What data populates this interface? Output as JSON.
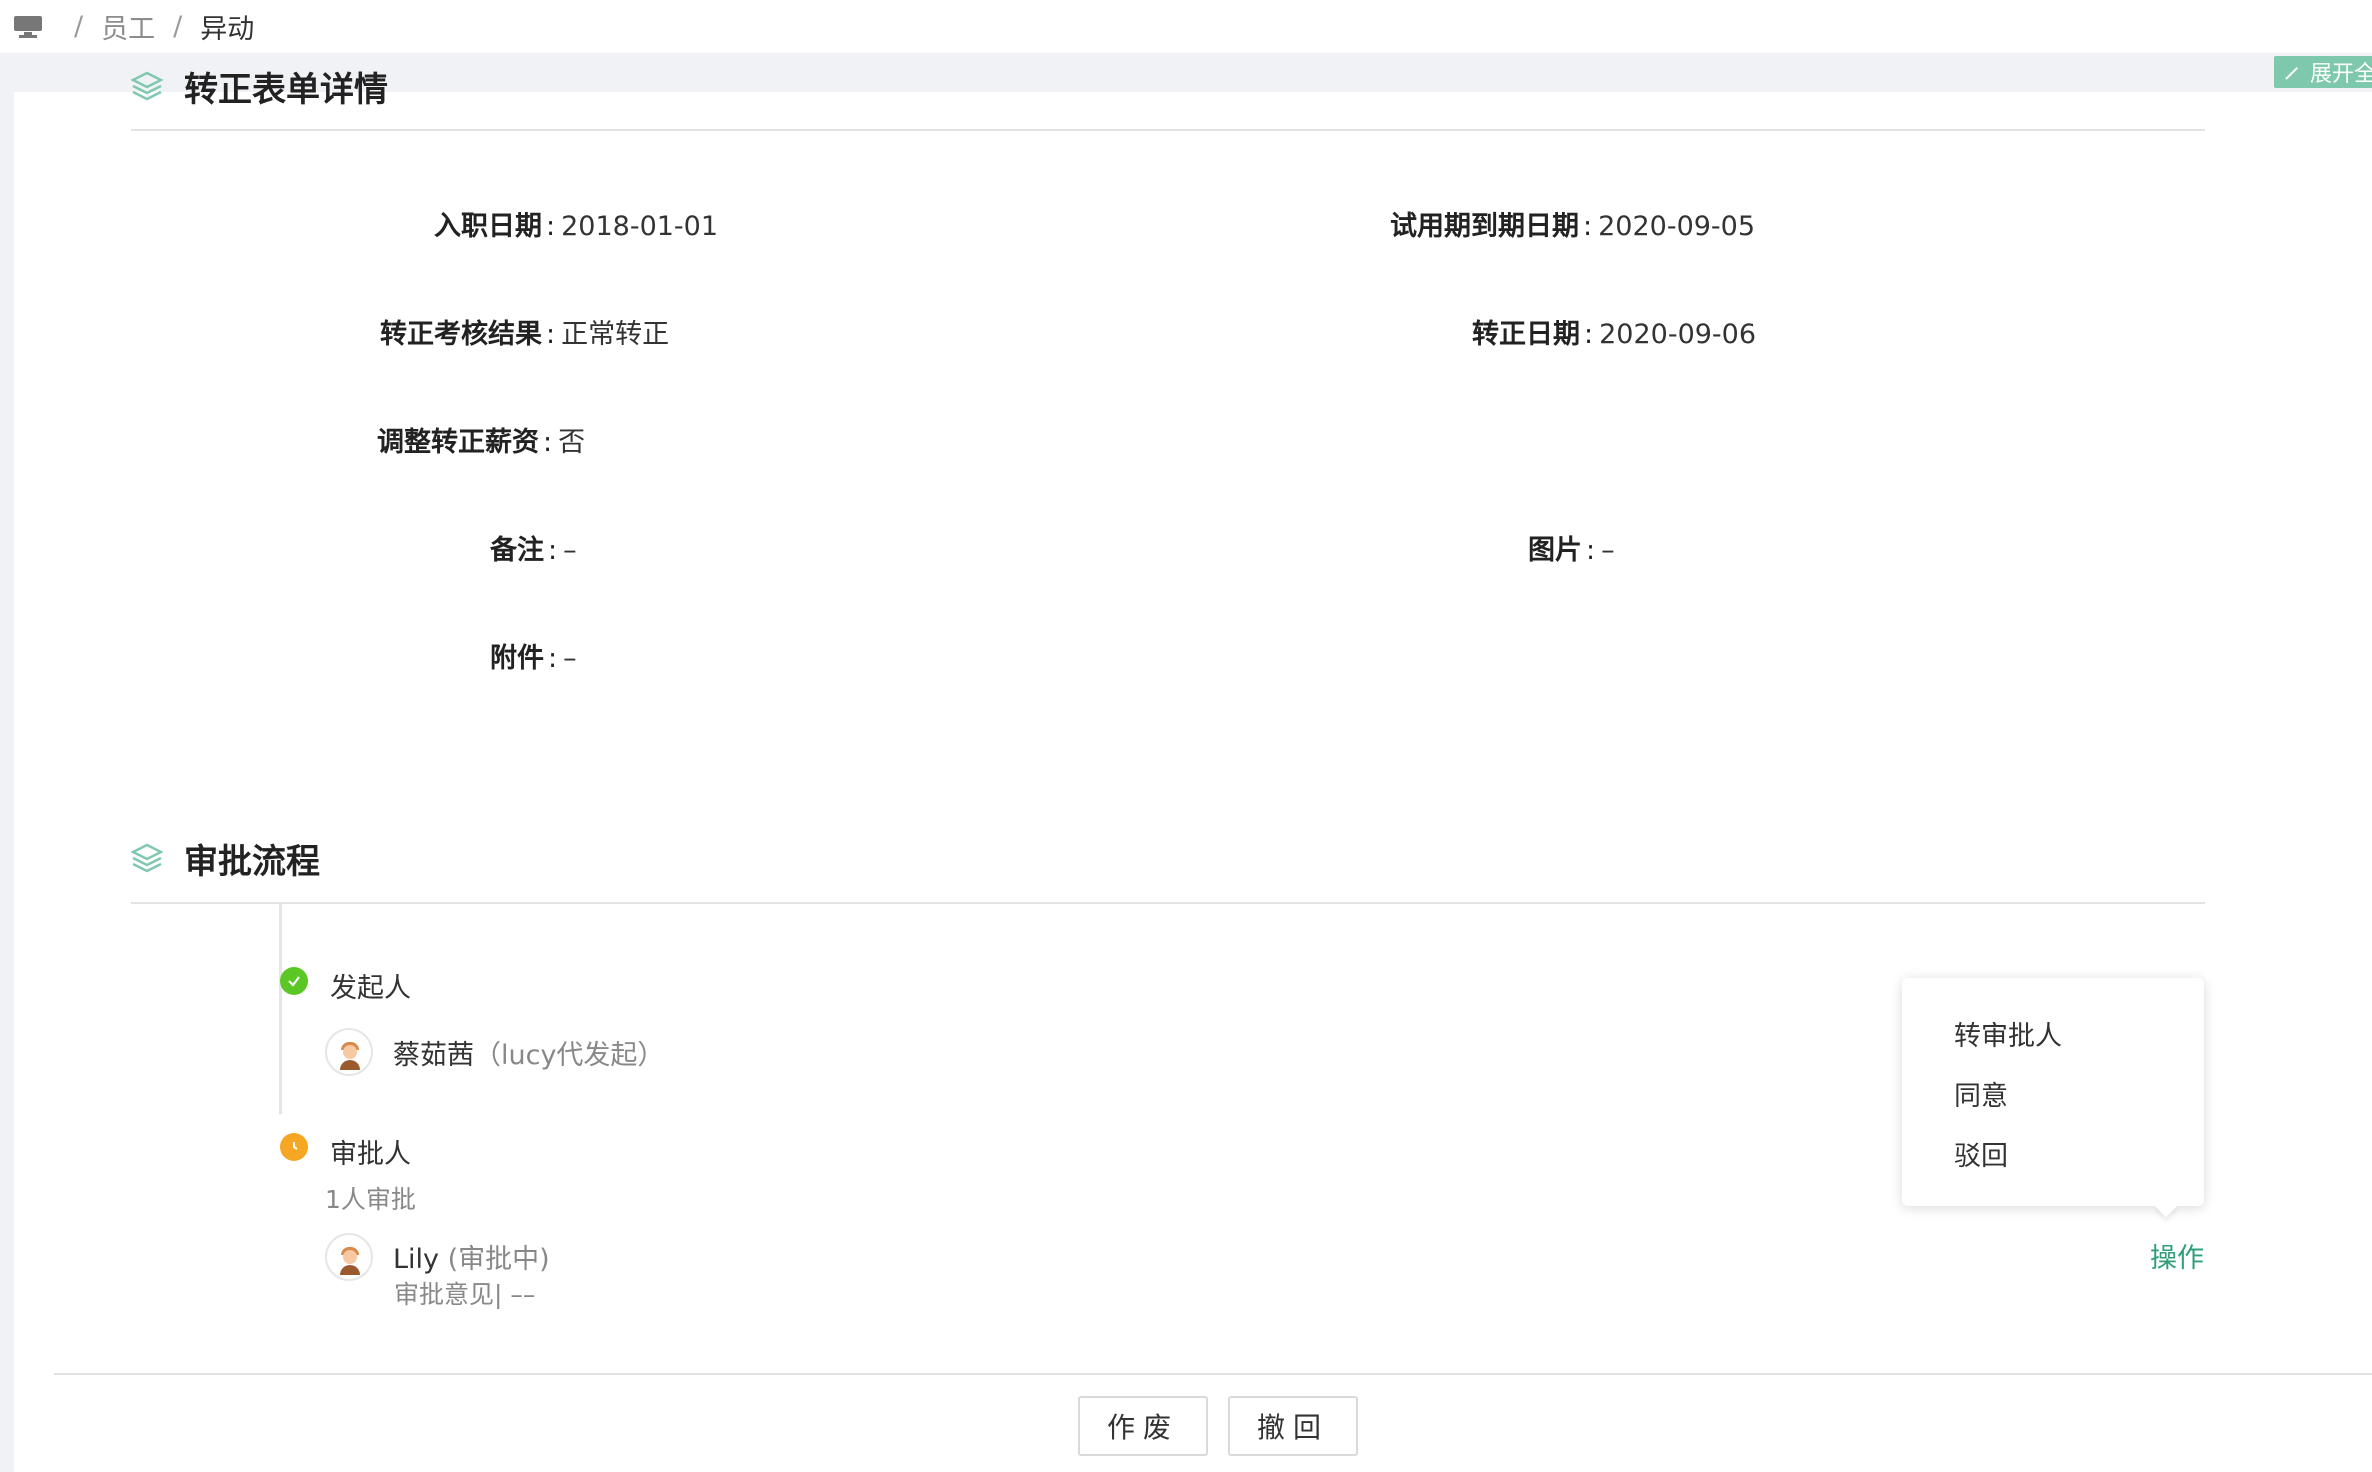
{
  "breadcrumb": {
    "home_icon": "computer-icon",
    "separator": "/",
    "items": [
      "员工",
      "异动"
    ]
  },
  "expand_button": {
    "label": "展开全",
    "icon": "expand-arrows-icon"
  },
  "sections": {
    "form_details": {
      "title": "转正表单详情",
      "fields": {
        "hire_date": {
          "label": "入职日期",
          "value": "2018-01-01"
        },
        "probation_end": {
          "label": "试用期到期日期",
          "value": "2020-09-05"
        },
        "assessment_result": {
          "label": "转正考核结果",
          "value": "正常转正"
        },
        "regular_date": {
          "label": "转正日期",
          "value": "2020-09-06"
        },
        "adjust_salary": {
          "label": "调整转正薪资",
          "value": "否"
        },
        "remark": {
          "label": "备注",
          "value": "–"
        },
        "picture": {
          "label": "图片",
          "value": "–"
        },
        "attachment": {
          "label": "附件",
          "value": "–"
        }
      }
    },
    "approval_flow": {
      "title": "审批流程",
      "initiator": {
        "title": "发起人",
        "name": "蔡茹茜",
        "note": "（lucy代发起）",
        "status_color": "#5ac725"
      },
      "approver": {
        "title": "审批人",
        "count_text": "1人审批",
        "name": "Lily",
        "status": "(审批中)",
        "opinion": "审批意见| ––",
        "status_color": "#f5a623"
      }
    }
  },
  "action_menu": {
    "items": [
      "转审批人",
      "同意",
      "驳回"
    ],
    "trigger_label": "操作",
    "trigger_color": "#2e9f7a"
  },
  "footer_buttons": {
    "void": "作废",
    "withdraw": "撤回"
  },
  "colors": {
    "accent": "#7ec8ae",
    "success": "#5ac725",
    "pending": "#f5a623"
  }
}
